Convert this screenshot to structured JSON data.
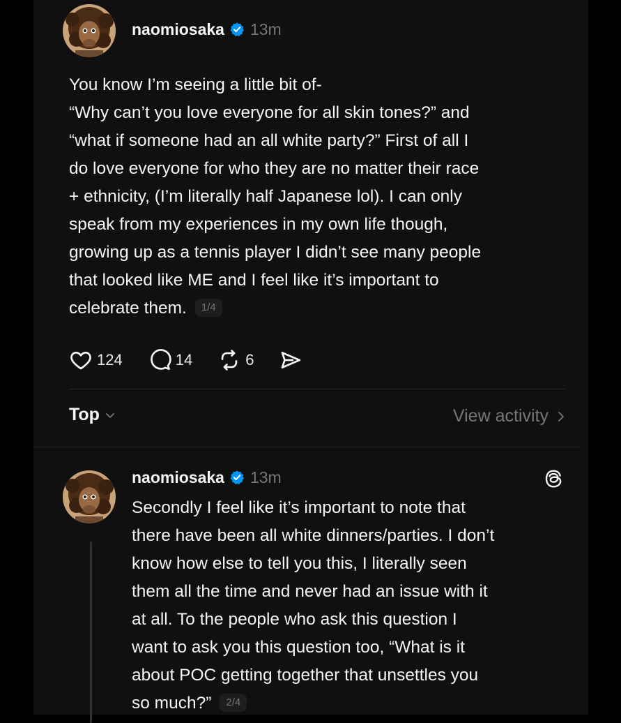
{
  "post1": {
    "username": "naomiosaka",
    "time": "13m",
    "paragraph1": "You know I’m seeing a little bit of-",
    "paragraph2": " “Why can’t you love everyone for all skin tones?” and\n“what if someone had an all white party?” First of all I\ndo love everyone for who they are no matter their race\n+ ethnicity, (I’m literally half Japanese lol). I can only\nspeak from my experiences in my own life though,\ngrowing up as a tennis player I didn’t see many people\nthat looked like ME and I feel like it’s important to\ncelebrate them.",
    "page_badge": "1/4",
    "likes": "124",
    "replies": "14",
    "reposts": "6"
  },
  "sort": {
    "label": "Top"
  },
  "view_activity": {
    "label": "View activity"
  },
  "post2": {
    "username": "naomiosaka",
    "time": "13m",
    "text": "Secondly I feel like it’s important to note that\nthere have been all white dinners/parties. I don’t\nknow how else to tell you this, I literally seen\nthem all the time and never had an issue with it\nat all. To the people who ask this question I\nwant to ask you this question too, “What is it\nabout POC getting together that unsettles you\nso much?”",
    "page_badge": "2/4"
  },
  "colors": {
    "background": "#101010",
    "text": "#f3f5f7",
    "muted": "#777777",
    "verified": "#0095f6"
  },
  "icons": [
    "heart-icon",
    "comment-icon",
    "repost-icon",
    "share-icon",
    "verified-badge-icon",
    "chevron-down-icon",
    "chevron-right-icon",
    "threads-logo-icon"
  ]
}
